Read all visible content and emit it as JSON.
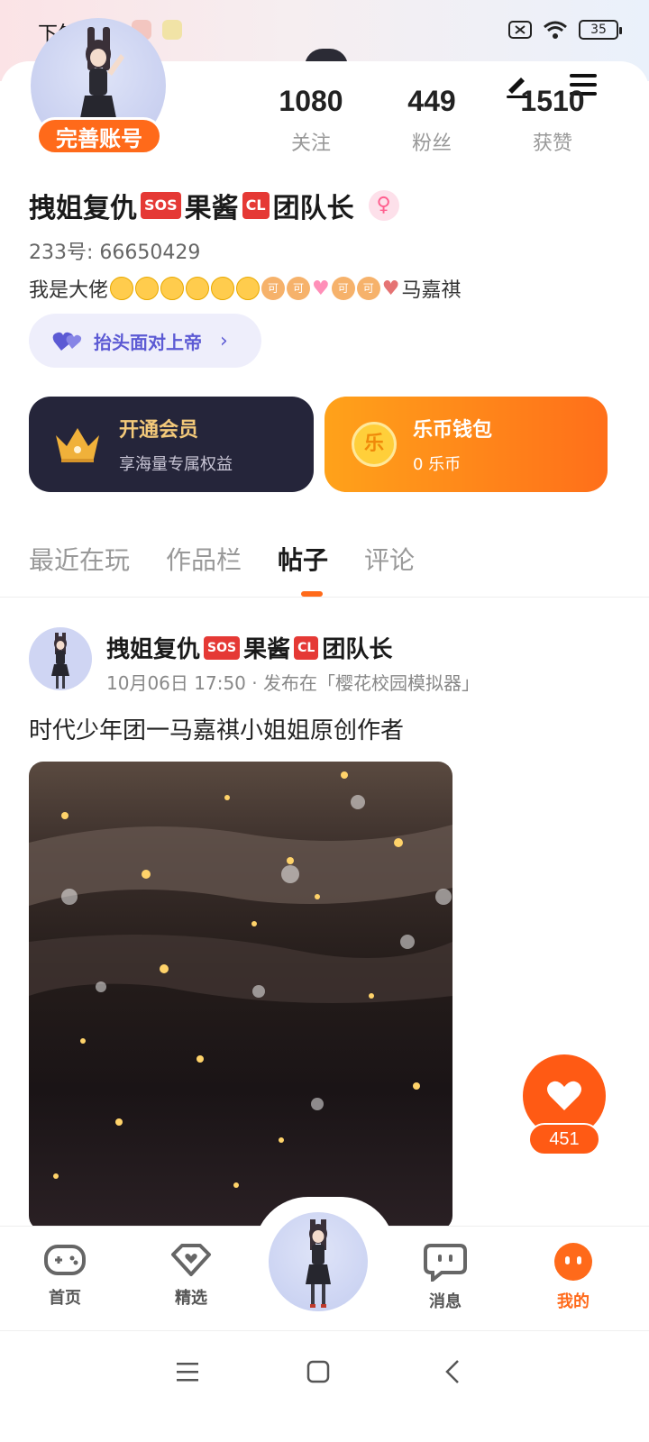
{
  "status_bar": {
    "time": "下午1:04",
    "battery": "35"
  },
  "profile": {
    "complete_label": "完善账号",
    "stats": [
      {
        "value": "1080",
        "label": "关注"
      },
      {
        "value": "449",
        "label": "粉丝"
      },
      {
        "value": "1510",
        "label": "获赞"
      }
    ],
    "username_parts": [
      "拽姐复仇",
      "SOS",
      "果酱",
      "CL",
      "团队长"
    ],
    "id_line": "233号: 66650429",
    "bio_prefix": "我是大佬",
    "bio_suffix": "马嘉祺",
    "motto": "抬头面对上帝"
  },
  "cards": {
    "vip": {
      "title": "开通会员",
      "subtitle": "享海量专属权益"
    },
    "wallet": {
      "icon_text": "乐",
      "title": "乐币钱包",
      "subtitle": "0 乐币"
    }
  },
  "tabs": [
    "最近在玩",
    "作品栏",
    "帖子",
    "评论"
  ],
  "post": {
    "author_parts": [
      "拽姐复仇",
      "SOS",
      "果酱",
      "CL",
      "团队长"
    ],
    "meta": "10月06日 17:50 · 发布在「樱花校园模拟器」",
    "text": "时代少年团一马嘉祺小姐姐原创作者",
    "like_count": "451"
  },
  "bottom_nav": {
    "home": "首页",
    "featured": "精选",
    "messages": "消息",
    "mine": "我的"
  },
  "colors": {
    "accent": "#ff6a1a",
    "vip_bg": "#25253a",
    "motto": "#5c5ad4"
  }
}
